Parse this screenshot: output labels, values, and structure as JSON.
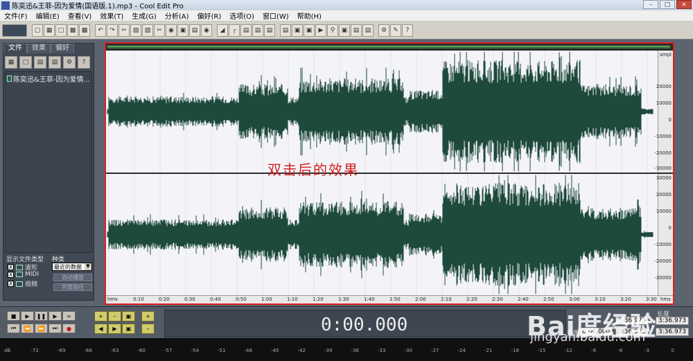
{
  "window": {
    "title": "陈奕迅&王菲-因为爱情(国语版.1).mp3 - Cool Edit Pro"
  },
  "menu": [
    "文件(F)",
    "编辑(E)",
    "查看(V)",
    "效果(T)",
    "生成(G)",
    "分析(A)",
    "偏好(R)",
    "选项(O)",
    "窗口(W)",
    "帮助(H)"
  ],
  "left_panel": {
    "tabs": [
      "文件",
      "效果",
      "偏好"
    ],
    "files": [
      "陈奕迅&王菲-因为爱情..."
    ],
    "filter_label": "显示文件类型",
    "kind_label": "种类",
    "select_value": "最近的数据",
    "types": [
      "波形",
      "MIDI",
      "视频"
    ],
    "buttons": [
      "自动播放",
      "完整路径"
    ]
  },
  "wave": {
    "overlay_text": "双击后的效果",
    "scale_top": [
      "smpl",
      "20000",
      "10000",
      "0",
      "-10000",
      "-20000",
      "-30000"
    ],
    "scale_bottom": [
      "30000",
      "20000",
      "10000",
      "0",
      "-10000",
      "-20000",
      "-30000"
    ],
    "time_ticks": [
      "hms",
      "0:10",
      "0:20",
      "0:30",
      "0:40",
      "0:50",
      "1:00",
      "1:10",
      "1:20",
      "1:30",
      "1:40",
      "1:50",
      "2:00",
      "2:10",
      "2:20",
      "2:30",
      "2:40",
      "2:50",
      "3:00",
      "3:10",
      "3:20",
      "3:30",
      "hms"
    ],
    "colors": {
      "waveform": "#1e4a3c",
      "selection_border": "#e02020"
    }
  },
  "transport": {
    "time_display": "0:00.000",
    "length_label": "长度",
    "range_label": "范围",
    "values": [
      "3:36.973",
      "0:00.000",
      "3:36.973",
      "3:36.973"
    ]
  },
  "level_meter": {
    "ticks": [
      "dB",
      "-72",
      "-69",
      "-66",
      "-63",
      "-60",
      "-57",
      "-54",
      "-51",
      "-48",
      "-45",
      "-42",
      "-39",
      "-36",
      "-33",
      "-30",
      "-27",
      "-24",
      "-21",
      "-18",
      "-15",
      "-12",
      "-9",
      "-6",
      "-3",
      "0"
    ]
  },
  "watermark": {
    "brand": "Bai度经验",
    "url": "jingyan.baidu.com"
  }
}
